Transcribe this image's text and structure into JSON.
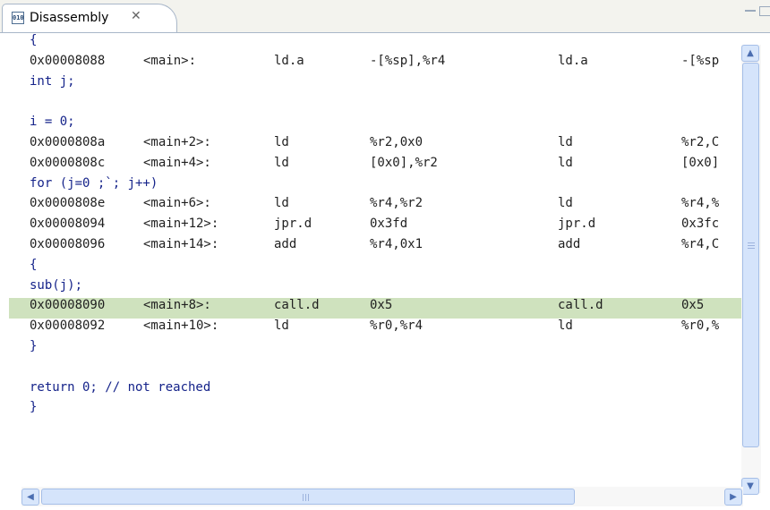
{
  "window": {
    "tab_title": "Disassembly",
    "tab_icon_text": "010",
    "close_glyph": "✕",
    "minimize_glyph": "",
    "maximize_glyph": ""
  },
  "disassembly": {
    "lines": [
      {
        "kind": "source",
        "text": "{"
      },
      {
        "kind": "asm",
        "address": "0x00008088",
        "label": "<main>:",
        "op1": "ld.a",
        "arg1": "-[%sp],%r4",
        "op2": "ld.a",
        "arg2": "-[%sp"
      },
      {
        "kind": "source",
        "text": "    int j;"
      },
      {
        "kind": "source",
        "text": ""
      },
      {
        "kind": "source",
        "text": "    i = 0;"
      },
      {
        "kind": "asm",
        "address": "0x0000808a",
        "label": "<main+2>:",
        "op1": "ld",
        "arg1": "%r2,0x0",
        "op2": "ld",
        "arg2": "%r2,C"
      },
      {
        "kind": "asm",
        "address": "0x0000808c",
        "label": "<main+4>:",
        "op1": "ld",
        "arg1": "[0x0],%r2",
        "op2": "ld",
        "arg2": "[0x0]"
      },
      {
        "kind": "source",
        "text": "    for (j=0 ;`; j++)"
      },
      {
        "kind": "asm",
        "address": "0x0000808e",
        "label": "<main+6>:",
        "op1": "ld",
        "arg1": "%r4,%r2",
        "op2": "ld",
        "arg2": "%r4,%"
      },
      {
        "kind": "asm",
        "address": "0x00008094",
        "label": "<main+12>:",
        "op1": "jpr.d",
        "arg1": "0x3fd",
        "op2": "jpr.d",
        "arg2": "0x3fc"
      },
      {
        "kind": "asm",
        "address": "0x00008096",
        "label": "<main+14>:",
        "op1": "add",
        "arg1": "%r4,0x1",
        "op2": "add",
        "arg2": "%r4,C"
      },
      {
        "kind": "source",
        "text": "    {"
      },
      {
        "kind": "source",
        "text": "        sub(j);"
      },
      {
        "kind": "asm",
        "highlight": true,
        "address": "0x00008090",
        "label": "<main+8>:",
        "op1": "call.d",
        "arg1": "0x5",
        "op2": "call.d",
        "arg2": "0x5"
      },
      {
        "kind": "asm",
        "address": "0x00008092",
        "label": "<main+10>:",
        "op1": "ld",
        "arg1": "%r0,%r4",
        "op2": "ld",
        "arg2": "%r0,%"
      },
      {
        "kind": "source",
        "text": "    }"
      },
      {
        "kind": "source",
        "text": ""
      },
      {
        "kind": "source",
        "text": "    return 0;   // not reached"
      },
      {
        "kind": "source",
        "text": "}"
      }
    ]
  },
  "scrollbars": {
    "vertical_position": 0.04,
    "horizontal_position": 0.0
  }
}
